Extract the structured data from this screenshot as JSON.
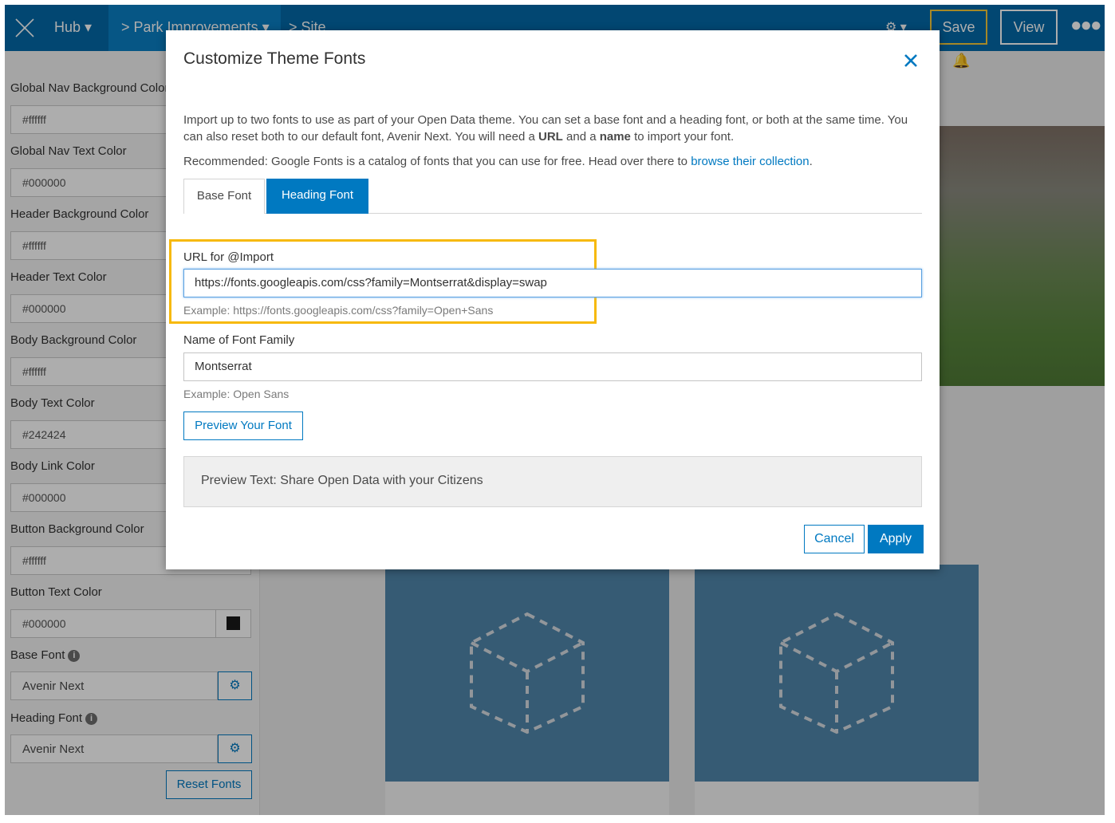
{
  "nav": {
    "hub_label": "Hub ▾",
    "breadcrumb_active": "> Park Improvements ▾",
    "breadcrumb_site": "> Site",
    "apps_label": "⚙ ▾",
    "save_label": "Save",
    "view_label": "View",
    "more_label": "●●●"
  },
  "sidebar": {
    "fields": [
      {
        "label": "Global Nav Background Color",
        "value": "#ffffff"
      },
      {
        "label": "Global Nav Text Color",
        "value": "#000000"
      },
      {
        "label": "Header Background Color",
        "value": "#ffffff"
      },
      {
        "label": "Header Text Color",
        "value": "#000000"
      },
      {
        "label": "Body Background Color",
        "value": "#ffffff"
      },
      {
        "label": "Body Text Color",
        "value": "#242424"
      },
      {
        "label": "Body Link Color",
        "value": "#000000"
      },
      {
        "label": "Button Background Color",
        "value": "#ffffff"
      },
      {
        "label": "Button Text Color",
        "value": "#000000"
      }
    ],
    "base_font_label": "Base Font",
    "base_font_value": "Avenir Next",
    "heading_font_label": "Heading Font",
    "heading_font_value": "Avenir Next",
    "info_glyph": "i",
    "gear_glyph": "⚙",
    "reset_label": "Reset Fonts"
  },
  "canvas": {
    "bell_glyph": "🔔"
  },
  "modal": {
    "title": "Customize Theme Fonts",
    "intro_1": "Import up to two fonts to use as part of your Open Data theme. You can set a base font and a heading font, or both at the same time. You can also reset both to our default font, Avenir Next. You will need a ",
    "intro_url": "URL",
    "intro_2": " and a ",
    "intro_name": "name",
    "intro_3": " to import your font.",
    "recommended": "Recommended: Google Fonts is a catalog of fonts that you can use for free. Head over there to ",
    "recommended_link": "browse their collection",
    "recommended_end": ".",
    "tabs": [
      "Base Font",
      "Heading Font"
    ],
    "active_tab": "Heading Font",
    "url_label": "URL for @Import",
    "url_value": "https://fonts.googleapis.com/css?family=Montserrat&display=swap",
    "url_hint": "Example: https://fonts.googleapis.com/css?family=Open+Sans",
    "name_label": "Name of Font Family",
    "name_value": "Montserrat",
    "name_hint": "Example: Open Sans",
    "preview_button": "Preview Your Font",
    "preview_text": "Preview Text: Share Open Data with your Citizens",
    "cancel_label": "Cancel",
    "apply_label": "Apply"
  },
  "colors": {
    "brand_dark": "#0369a8",
    "brand_active": "#0a7fc4",
    "accent": "#0079c1",
    "highlight": "#f7b90b"
  }
}
